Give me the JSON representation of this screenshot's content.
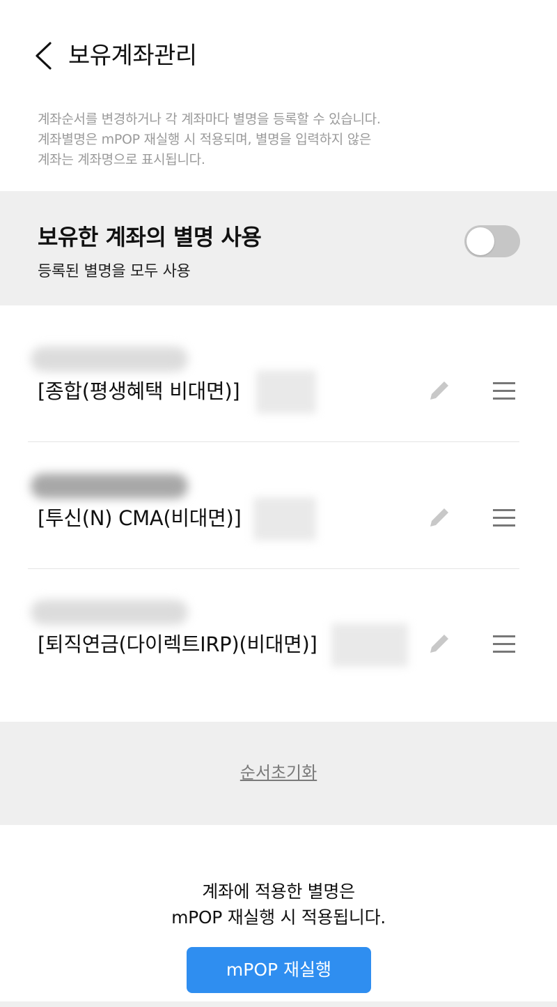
{
  "header": {
    "title": "보유계좌관리"
  },
  "description": {
    "lines": [
      "계좌순서를 변경하거나 각 계좌마다 별명을 등록할 수 있습니다.",
      "계좌별명은 mPOP 재실행 시 적용되며, 별명을 입력하지 않은",
      "계좌는 계좌명으로 표시됩니다."
    ]
  },
  "alias_toggle": {
    "title": "보유한 계좌의 별명 사용",
    "subtitle": "등록된 별명을 모두 사용",
    "enabled": false
  },
  "accounts": [
    {
      "name": "[종합(평생혜택 비대면)]"
    },
    {
      "name": "[투신(N) CMA(비대면)]"
    },
    {
      "name": "[퇴직연금(다이렉트IRP)(비대면)]"
    }
  ],
  "reset": {
    "label": "순서초기화"
  },
  "notice": {
    "lines": [
      "계좌에 적용한 별명은",
      "mPOP 재실행 시 적용됩니다."
    ]
  },
  "restart_button": {
    "label": "mPOP 재실행"
  },
  "colors": {
    "primary": "#2f8ef0",
    "panel": "#efefef",
    "toggle_off": "#c6c6c6",
    "icon_gray": "#c8c8c8",
    "handle_gray": "#777777",
    "muted_text": "#9a9a9a"
  }
}
